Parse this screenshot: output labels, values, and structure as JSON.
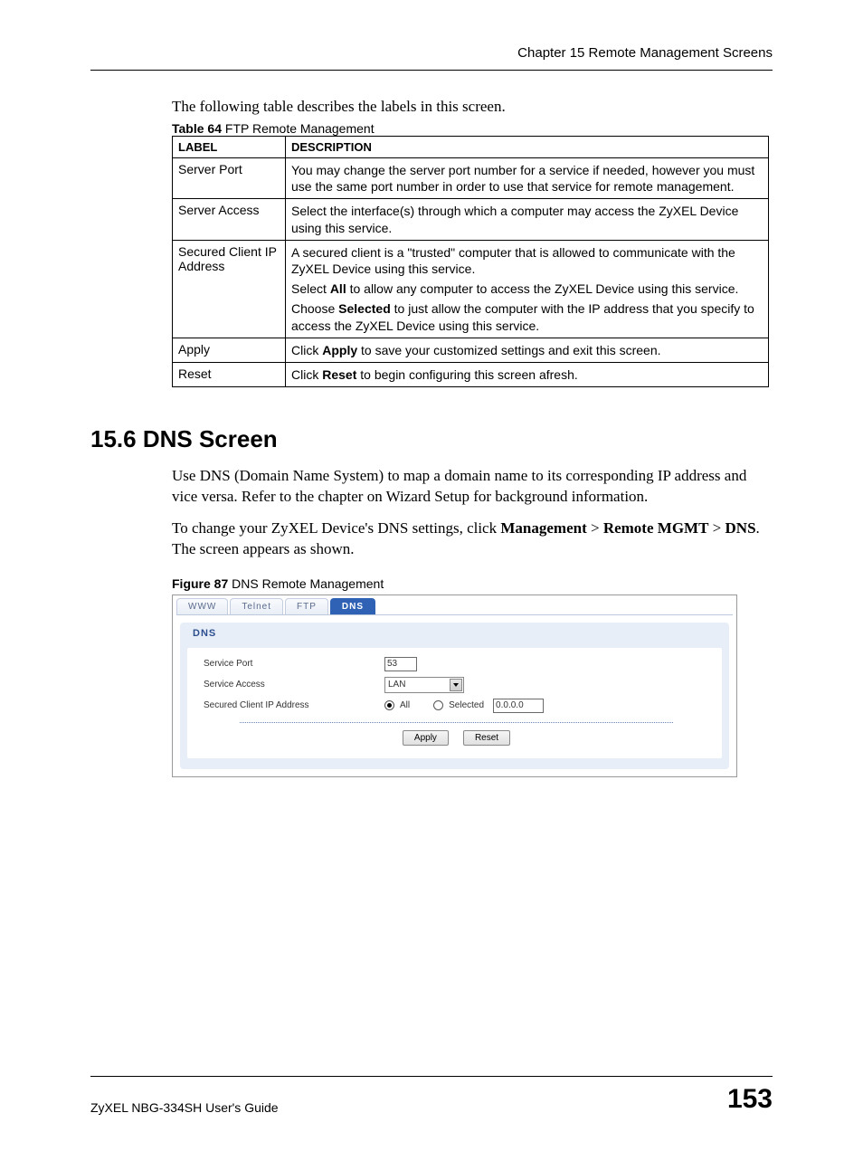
{
  "header": {
    "chapter": "Chapter 15 Remote Management Screens"
  },
  "intro": "The following table describes the labels in this screen.",
  "table64": {
    "caption_bold": "Table 64",
    "caption_rest": "   FTP Remote Management",
    "head_label": "LABEL",
    "head_desc": "DESCRIPTION",
    "rows": {
      "r0_label": "Server Port",
      "r0_d0": "You may change the server port number for a service if needed, however you must use the same port number in order to use that service for remote management.",
      "r1_label": "Server Access",
      "r1_d0": "Select the interface(s) through which a computer may access the ZyXEL Device using this service.",
      "r2_label": "Secured Client IP Address",
      "r2_d0": "A secured client is a \"trusted\" computer that is allowed to communicate with the ZyXEL Device using this service.",
      "r2_d1a": "Select ",
      "r2_d1b": "All",
      "r2_d1c": " to allow any computer to access the ZyXEL Device using this service.",
      "r2_d2a": "Choose ",
      "r2_d2b": "Selected",
      "r2_d2c": " to just allow the computer with the IP address that you specify to access the ZyXEL Device using this service.",
      "r3_label": "Apply",
      "r3_d0a": "Click ",
      "r3_d0b": "Apply",
      "r3_d0c": " to save your customized settings and exit this screen.",
      "r4_label": "Reset",
      "r4_d0a": "Click ",
      "r4_d0b": "Reset",
      "r4_d0c": " to begin configuring this screen afresh."
    }
  },
  "section": {
    "heading": "15.6  DNS Screen"
  },
  "para1": "Use DNS (Domain Name System) to map a domain name to its corresponding IP address and vice versa. Refer to the chapter on Wizard Setup for background information.",
  "para2": {
    "a": "To change your ZyXEL Device's DNS settings, click ",
    "b": "Management",
    "c": " > ",
    "d": "Remote MGMT",
    "e": " > ",
    "f": "DNS",
    "g": ". The screen appears as shown."
  },
  "figure": {
    "bold": "Figure 87",
    "rest": "   DNS Remote Management"
  },
  "screenshot": {
    "tabs": {
      "www": "WWW",
      "telnet": "Telnet",
      "ftp": "FTP",
      "dns": "DNS"
    },
    "panel_title": "DNS",
    "labels": {
      "service_port": "Service Port",
      "service_access": "Service Access",
      "secured_ip": "Secured Client IP Address"
    },
    "values": {
      "port": "53",
      "access": "LAN",
      "radio_all": "All",
      "radio_selected": "Selected",
      "ip": "0.0.0.0"
    },
    "buttons": {
      "apply": "Apply",
      "reset": "Reset"
    }
  },
  "footer": {
    "guide": "ZyXEL NBG-334SH User's Guide",
    "page": "153"
  }
}
